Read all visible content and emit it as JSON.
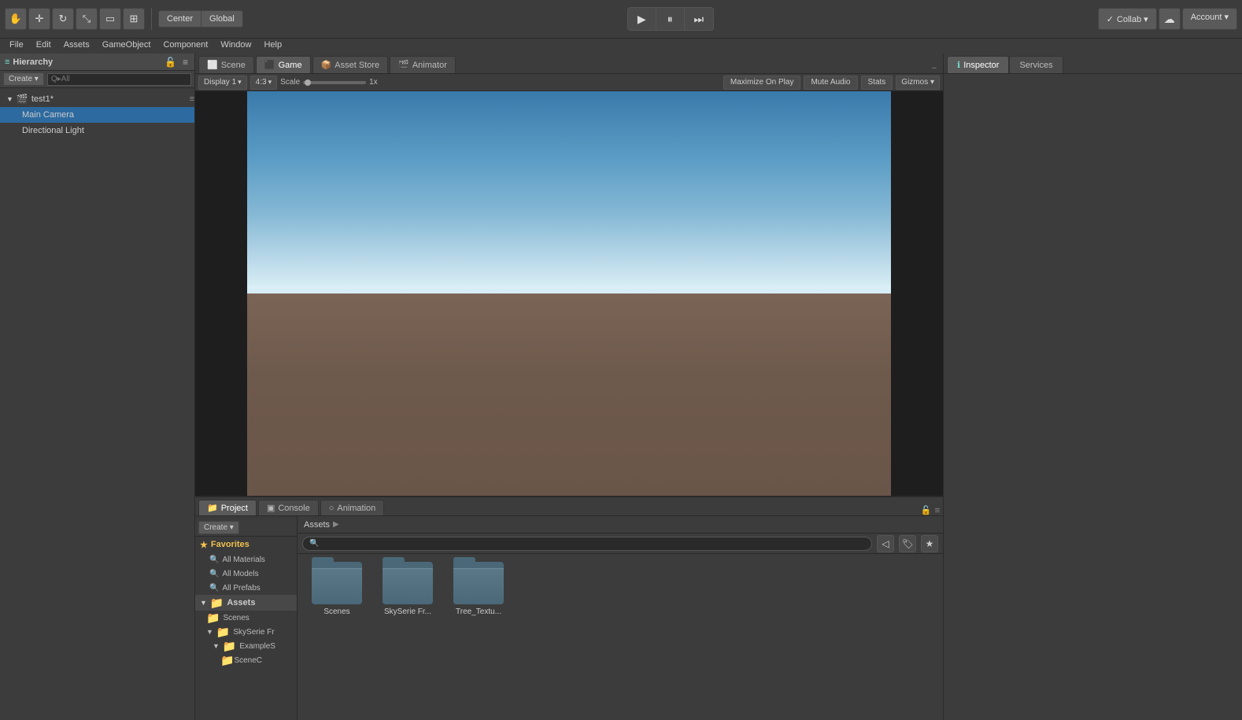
{
  "menu": {
    "items": [
      "File",
      "Edit",
      "Assets",
      "GameObject",
      "Component",
      "Window",
      "Help"
    ]
  },
  "toolbar": {
    "center_label": "Center",
    "global_label": "Global",
    "play_btn": "▶",
    "pause_btn": "⏸",
    "step_btn": "⏭",
    "collab_label": "Collab ▾",
    "account_label": "Account ▾"
  },
  "scene_tabs": [
    {
      "label": "Scene",
      "icon": "⬜",
      "active": false
    },
    {
      "label": "Game",
      "icon": "⬛",
      "active": true
    },
    {
      "label": "Asset Store",
      "icon": "📦",
      "active": false
    },
    {
      "label": "Animator",
      "icon": "🎬",
      "active": false
    }
  ],
  "game_toolbar": {
    "display": "Display 1",
    "aspect": "4:3",
    "scale_label": "Scale",
    "scale_value": "1x",
    "maximize": "Maximize On Play",
    "mute": "Mute Audio",
    "stats": "Stats",
    "gizmos": "Gizmos ▾"
  },
  "hierarchy": {
    "title": "Hierarchy",
    "create_label": "Create ▾",
    "search_placeholder": "Q▸All",
    "scene_name": "test1*",
    "items": [
      {
        "label": "Main Camera",
        "selected": true
      },
      {
        "label": "Directional Light",
        "selected": false
      }
    ]
  },
  "inspector": {
    "title": "Inspector",
    "tabs": [
      "Inspector",
      "Services"
    ]
  },
  "project": {
    "tabs": [
      "Project",
      "Console",
      "Animation"
    ],
    "create_label": "Create ▾",
    "breadcrumb": [
      "Assets",
      "▶"
    ],
    "sidebar": {
      "favorites_label": "Favorites",
      "items": [
        "All Materials",
        "All Models",
        "All Prefabs"
      ],
      "assets_label": "Assets",
      "sub_items": [
        "Scenes",
        "SkySerie Fr"
      ],
      "sub_sub_items": [
        "ExampleS",
        "SceneC"
      ]
    },
    "assets": [
      {
        "label": "Scenes"
      },
      {
        "label": "SkySerie Fr..."
      },
      {
        "label": "Tree_Textu..."
      }
    ]
  }
}
